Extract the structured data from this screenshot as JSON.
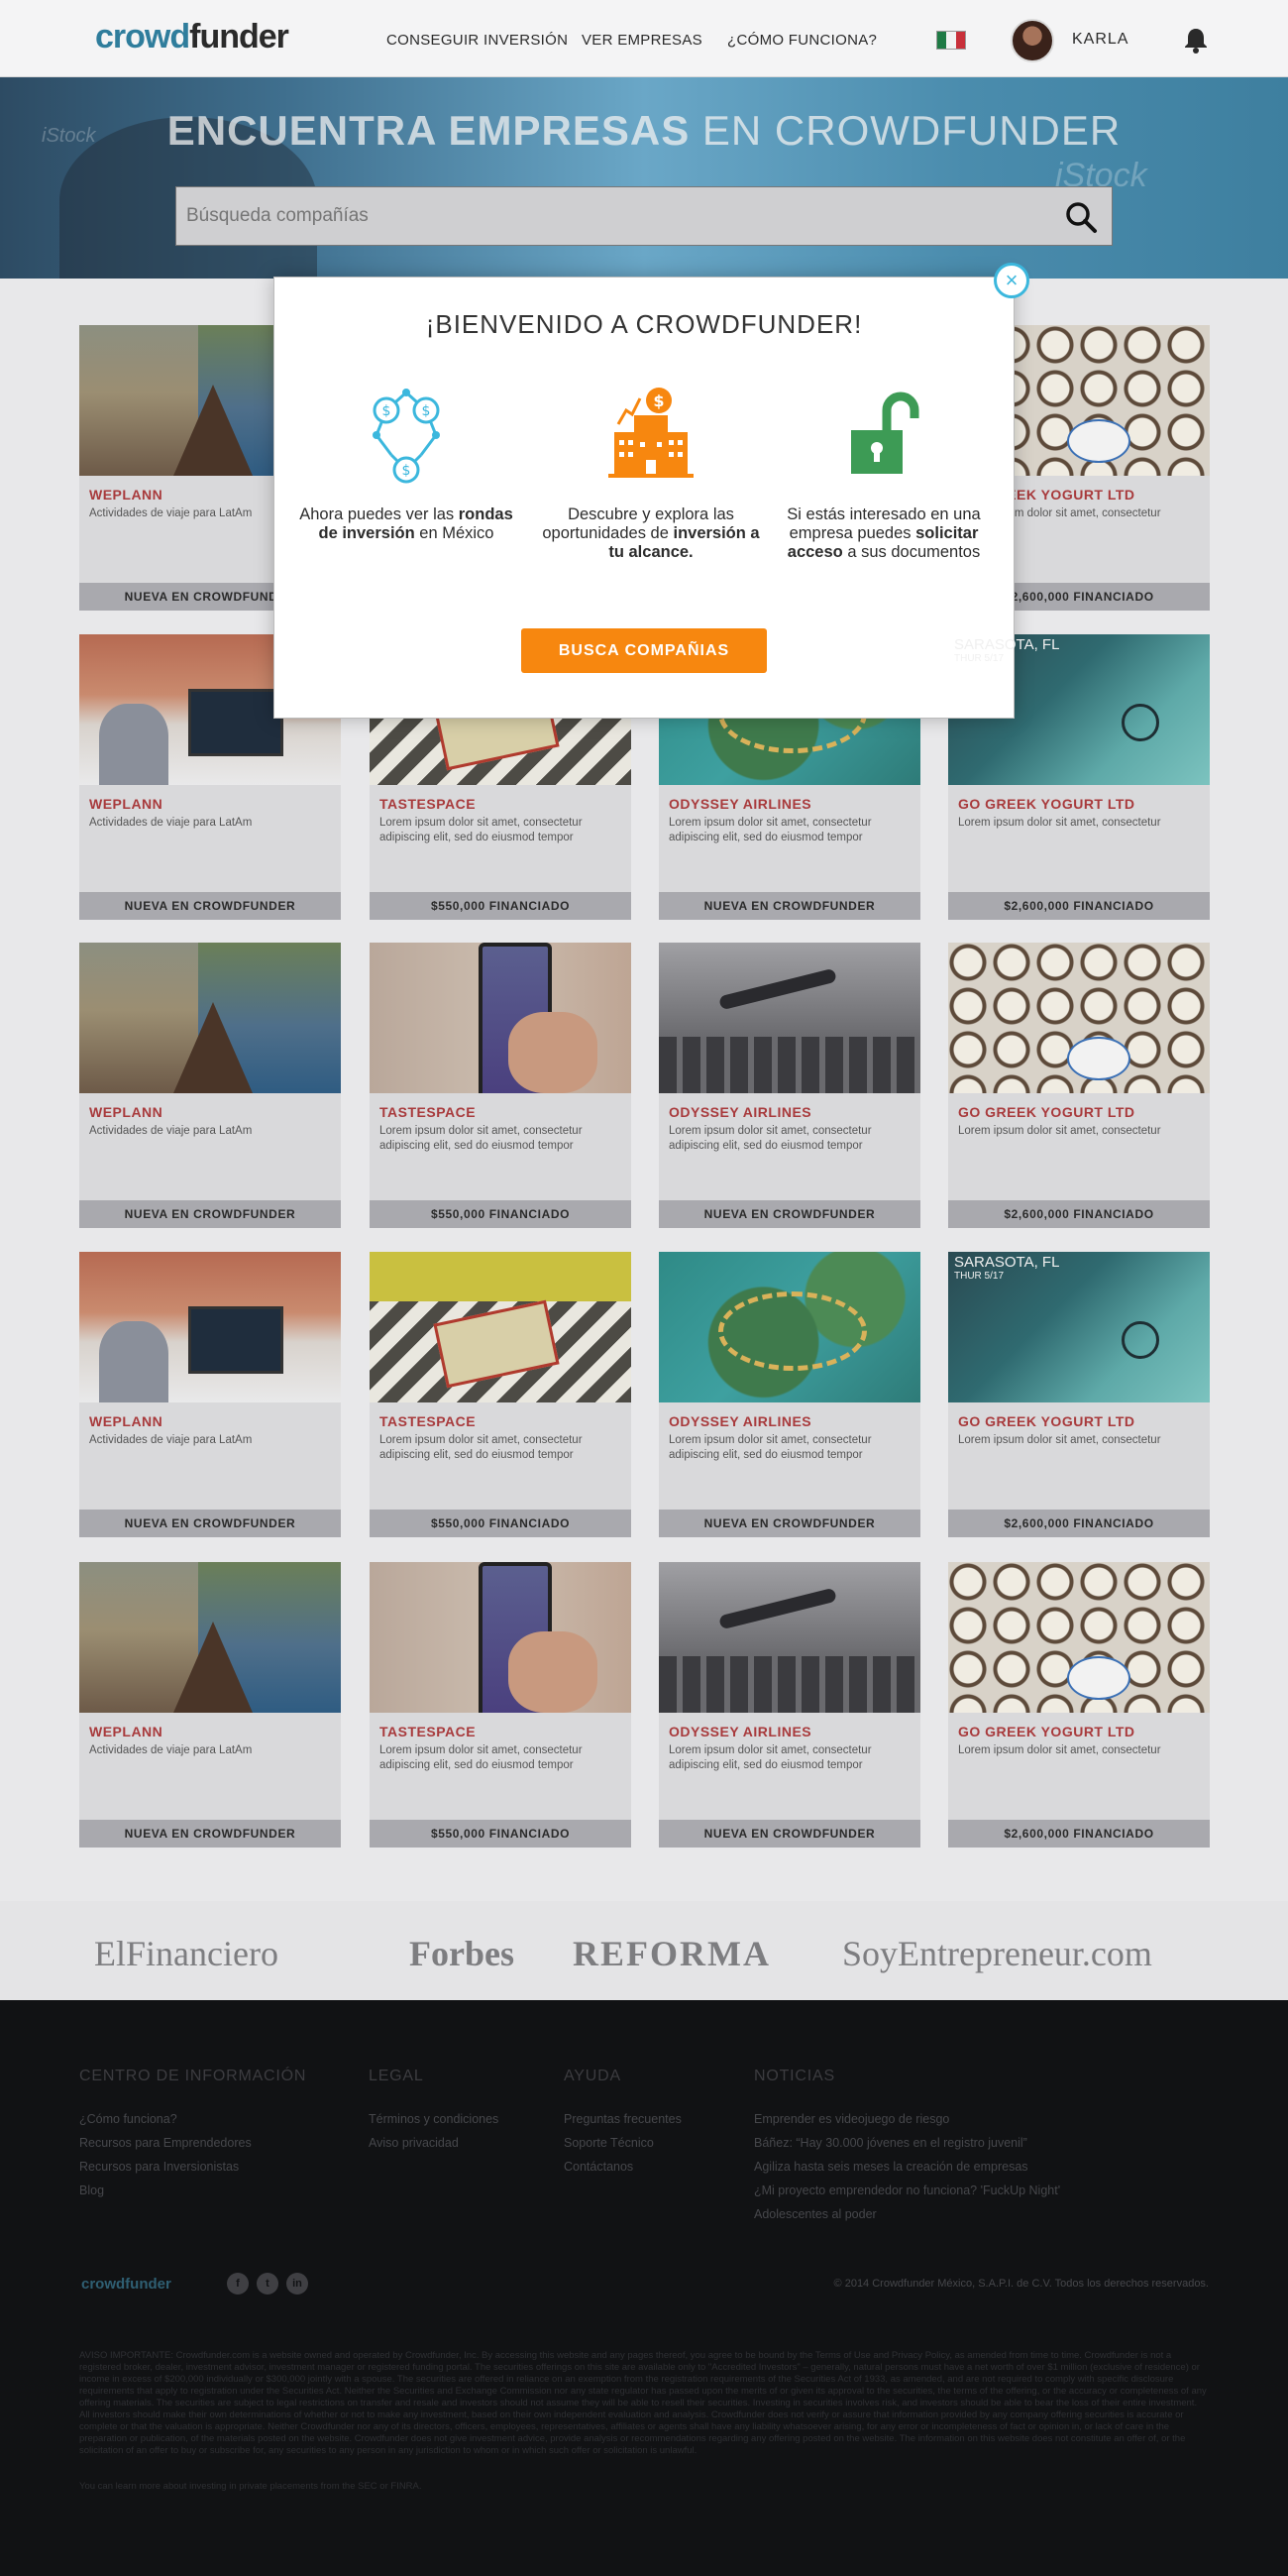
{
  "header": {
    "logo_part1": "crowd",
    "logo_part2": "funder",
    "nav": [
      "CONSEGUIR INVERSIÓN",
      "VER EMPRESAS",
      "¿CÓMO FUNCIONA?"
    ],
    "user_name": "KARLA",
    "flag_icon": "mexico-flag-icon",
    "notification_icon": "bell-icon"
  },
  "hero": {
    "title_bold": "ENCUENTRA EMPRESAS",
    "title_light": "EN CROWDFUNDER",
    "watermark": "iStock",
    "search_placeholder": "Búsqueda compañías",
    "search_icon": "search-icon"
  },
  "companies": [
    {
      "name": "WEPLANN",
      "desc": "Actividades de viaje para LatAm",
      "badge": "NUEVA EN CROWDFUNDER"
    },
    {
      "name": "TASTESPACE",
      "desc": "Lorem ipsum dolor sit amet, consectetur adipiscing elit, sed do eiusmod tempor",
      "badge": "$550,000 FINANCIADO"
    },
    {
      "name": "ODYSSEY AIRLINES",
      "desc": "Lorem ipsum dolor sit amet, consectetur adipiscing elit, sed do eiusmod tempor",
      "badge": "NUEVA EN CROWDFUNDER"
    },
    {
      "name": "GO GREEK YOGURT LTD",
      "desc": "Lorem ipsum dolor sit amet, consectetur",
      "badge": "$2,600,000 FINANCIADO"
    }
  ],
  "weather_card": {
    "city": "SARASOTA, FL",
    "date": "THUR 5/17"
  },
  "yogurt_logo": "GoGreek",
  "press": [
    "ElFinanciero",
    "Forbes",
    "REFORMA",
    "SoyEntrepreneur.com"
  ],
  "footer": {
    "columns": [
      {
        "title": "CENTRO DE INFORMACIÓN",
        "links": [
          "¿Cómo funciona?",
          "Recursos para Emprendedores",
          "Recursos para Inversionistas",
          "Blog"
        ]
      },
      {
        "title": "LEGAL",
        "links": [
          "Términos y condiciones",
          "Aviso privacidad"
        ]
      },
      {
        "title": "AYUDA",
        "links": [
          "Preguntas frecuentes",
          "Soporte Técnico",
          "Contáctanos"
        ]
      },
      {
        "title": "NOTICIAS",
        "links": [
          "Emprender es videojuego de riesgo",
          "Báñez: “Hay 30.000 jóvenes en el registro juvenil”",
          "Agiliza hasta seis meses la creación de empresas",
          "¿Mi proyecto emprendedor no funciona? 'FuckUp Night'",
          "Adolescentes al poder"
        ]
      }
    ],
    "logo": "crowdfunder",
    "social": [
      "f",
      "t",
      "in"
    ],
    "copyright": "© 2014 Crowdfunder México, S.A.P.I. de C.V. Todos los derechos reservados.",
    "disclaimer": "AVISO IMPORTANTE: Crowdfunder.com is a website owned and operated by Crowdfunder, Inc. By accessing this website and any pages thereof, you agree to be bound by the Terms of Use and Privacy Policy, as amended from time to time. Crowdfunder is not a registered broker, dealer, investment advisor, investment manager or registered funding portal. The securities offerings on this site are available only to \"Accredited Investors\" – generally, natural persons must have a net worth of over $1 million (exclusive of residence) or income in excess of $200,000 individually or $300,000 jointly with a spouse. The securities are offered in reliance on an exemption from the registration requirements of the Securities Act of 1933, as amended, and are not required to comply with specific disclosure requirements that apply to registration under the Securities Act. Neither the Securities and Exchange Commission nor any state regulator has passed upon the merits of or given its approval to the securities, the terms of the offering, or the accuracy or completeness of any offering materials. The securities are subject to legal restrictions on transfer and resale and investors should not assume they will be able to resell their securities. Investing in securities involves risk, and investors should be able to bear the loss of their entire investment. All investors should make their own determinations of whether or not to make any investment, based on their own independent evaluation and analysis. Crowdfunder does not verify or assure that information provided by any company offering securities is accurate or complete or that the valuation is appropriate. Neither Crowdfunder nor any of its directors, officers, employees, representatives, affiliates or agents shall have any liability whatsoever arising, for any error or incompleteness of fact or opinion in, or lack of care in the preparation or publication, of the materials posted on the website. Crowdfunder does not give investment advice, provide analysis or recommendations regarding any offering posted on the website. The information on this website does not constitute an offer of, or the solicitation of an offer to buy or subscribe for, any securities to any person in any jurisdiction to whom or in which such offer or solicitation is unlawful.",
    "learn_more": "You can learn more about investing in private placements from the SEC or FINRA."
  },
  "modal": {
    "title": "¡BIENVENIDO A CROWDFUNDER!",
    "close": "×",
    "col1_a": "Ahora puedes ver las ",
    "col1_b": "rondas de inversión",
    "col1_c": " en México",
    "col2_a": "Descubre y explora las oportunidades de ",
    "col2_b": "inversión a tu alcance.",
    "col3_a": "Si estás interesado en una empresa puedes ",
    "col3_b": "solicitar acceso",
    "col3_c": " a sus documentos",
    "cta": "BUSCA COMPAÑIAS",
    "icons": [
      "network-money-icon",
      "building-money-icon",
      "unlocked-padlock-icon"
    ]
  },
  "colors": {
    "accent": "#f7870f",
    "teal": "#3bb7dd",
    "green": "#3d9b55",
    "brand_blue": "#2f7d9c",
    "company_name": "#a83a3c"
  }
}
